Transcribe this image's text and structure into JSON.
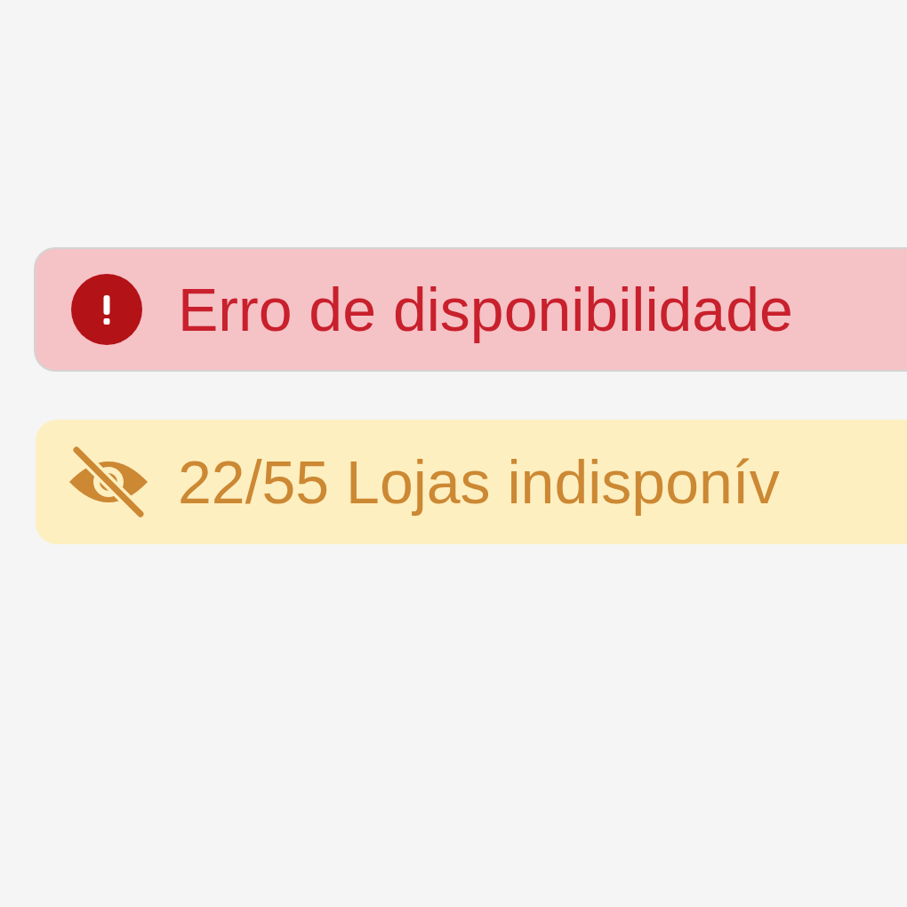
{
  "alerts": [
    {
      "kind": "error",
      "text": "Erro de disponibilidade"
    },
    {
      "kind": "warning",
      "text": "22/55 Lojas indisponív"
    }
  ]
}
